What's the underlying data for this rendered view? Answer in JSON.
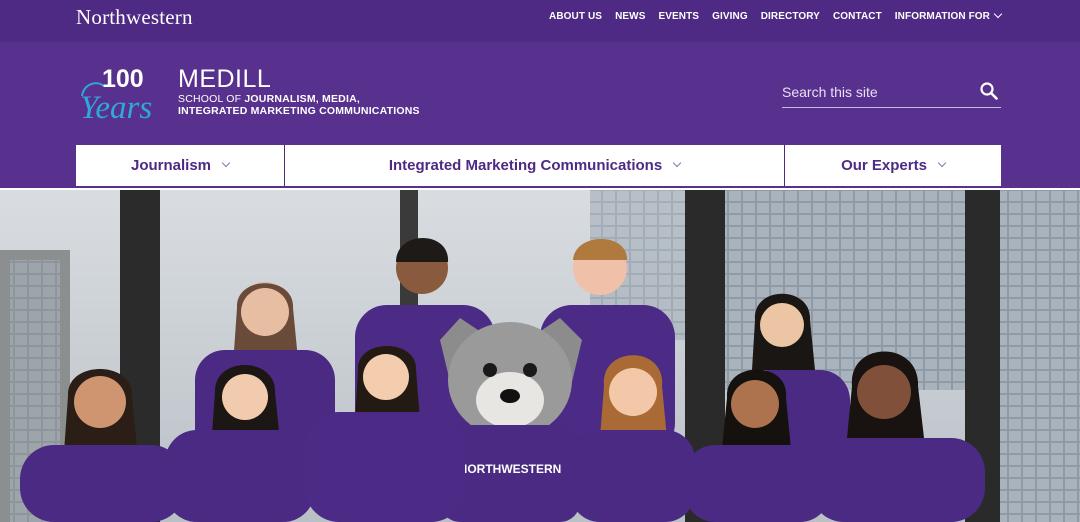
{
  "topbar": {
    "logo": "Northwestern",
    "links": [
      "ABOUT US",
      "NEWS",
      "EVENTS",
      "GIVING",
      "DIRECTORY",
      "CONTACT",
      "INFORMATION FOR"
    ]
  },
  "header": {
    "logo_number": "100",
    "logo_word": "Years",
    "school_name": "MEDILL",
    "school_line1_prefix": "SCHOOL OF ",
    "school_line1_bold": "JOURNALISM, MEDIA,",
    "school_line2": "INTEGRATED MARKETING COMMUNICATIONS"
  },
  "search": {
    "placeholder": "Search this site"
  },
  "nav": {
    "items": [
      "Journalism",
      "Integrated Marketing Communications",
      "Our Experts"
    ]
  },
  "hero": {
    "shirt_text": "NORTHWESTERN"
  },
  "colors": {
    "primary": "#4e2a84",
    "header": "#57318d",
    "logo_cyan": "#2fa9d8"
  }
}
